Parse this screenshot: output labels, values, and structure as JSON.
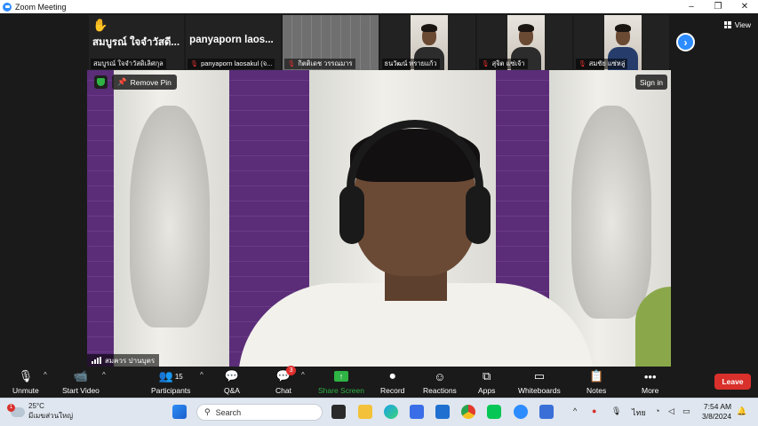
{
  "window": {
    "title": "Zoom Meeting",
    "controls": [
      "–",
      "❐",
      "✕"
    ]
  },
  "strip": {
    "hand_icon": "raised-hand",
    "tiles": [
      {
        "bigname": "สมบูรณ์ ใจจำวัสดี...",
        "label": "สมบูรณ์ ใจจำวัสดิเลิศกุล",
        "muted": false
      },
      {
        "bigname": "panyaporn  laos...",
        "label": "panyaporn laosakul (จ...",
        "muted": true
      },
      {
        "bigname": "",
        "label": "กิตติเดช วรรณมาร",
        "muted": true
      },
      {
        "bigname": "",
        "label": "ธนวัฒน์ ทรายแก้ว",
        "muted": false
      },
      {
        "bigname": "",
        "label": "สุจิต แซ่เจ้า",
        "muted": true
      },
      {
        "bigname": "",
        "label": "สมชัย แซ่หลู่",
        "muted": true
      }
    ],
    "view_label": "View"
  },
  "main_video": {
    "remove_pin": "Remove Pin",
    "sign_in": "Sign in",
    "speaker_name": "สมควร ปานบุตร"
  },
  "toolbar": {
    "unmute": "Unmute",
    "start_video": "Start Video",
    "participants": "Participants",
    "participants_count": "15",
    "qa": "Q&A",
    "chat": "Chat",
    "chat_badge": "3",
    "share_screen": "Share Screen",
    "record": "Record",
    "reactions": "Reactions",
    "apps": "Apps",
    "whiteboards": "Whiteboards",
    "notes": "Notes",
    "more": "More",
    "leave": "Leave",
    "share_color": "#2fb344",
    "leave_color": "#d9302c"
  },
  "taskbar": {
    "weather_temp": "25°C",
    "weather_desc": "มีเมฆส่วนใหญ่",
    "weather_badge": "1",
    "search_placeholder": "Search",
    "language": "ไทย",
    "time": "7:54 AM",
    "date": "3/8/2024"
  }
}
